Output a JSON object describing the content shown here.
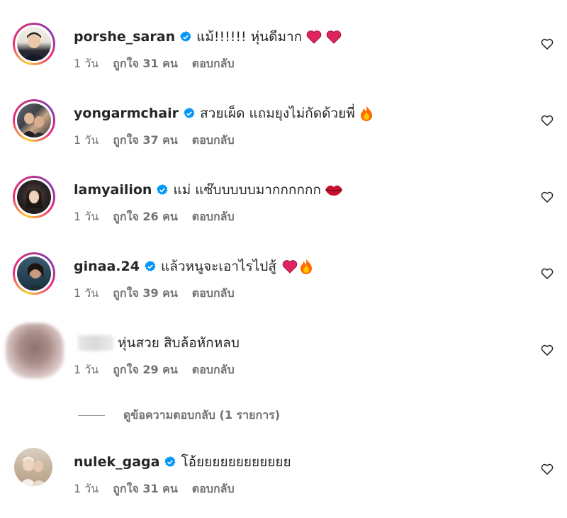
{
  "comments": [
    {
      "username": "porshe_saran",
      "verified": true,
      "text": "แม้!!!!!! หุ่นดีมาก",
      "emojis": [
        "red-heart",
        "red-heart"
      ],
      "time": "1 วัน",
      "likes": "ถูกใจ 31 คน",
      "reply": "ตอบกลับ"
    },
    {
      "username": "yongarmchair",
      "verified": true,
      "text": "สวยเผ็ด แถมยุงไม่กัดด้วยพี่",
      "emojis": [
        "fire"
      ],
      "time": "1 วัน",
      "likes": "ถูกใจ 37 คน",
      "reply": "ตอบกลับ"
    },
    {
      "username": "lamyailion",
      "verified": true,
      "text": "แม่ แซ๊บบบบบมากกกกกก",
      "emojis": [
        "lips"
      ],
      "time": "1 วัน",
      "likes": "ถูกใจ 26 คน",
      "reply": "ตอบกลับ"
    },
    {
      "username": "ginaa.24",
      "verified": true,
      "text": "แล้วหนูจะเอาไรไปสู้",
      "emojis": [
        "red-heart",
        "fire"
      ],
      "time": "1 วัน",
      "likes": "ถูกใจ 39 คน",
      "reply": "ตอบกลับ"
    },
    {
      "username": "",
      "verified": false,
      "text": "หุ่นสวย สิบล้อหักหลบ",
      "emojis": [],
      "time": "1 วัน",
      "likes": "ถูกใจ 29 คน",
      "reply": "ตอบกลับ"
    },
    {
      "username": "nulek_gaga",
      "verified": true,
      "text": "โอ้ยยยยยยยยยยยย",
      "emojis": [],
      "time": "1 วัน",
      "likes": "ถูกใจ 31 คน",
      "reply": "ตอบกลับ"
    }
  ],
  "view_replies": "ดูข้อความตอบกลับ (1 รายการ)",
  "colors": {
    "verified": "#0095f6",
    "heart_red": "#e0245e",
    "muted": "#737373"
  },
  "icons": {
    "like": "heart-outline-icon",
    "verified": "verified-badge-icon"
  }
}
